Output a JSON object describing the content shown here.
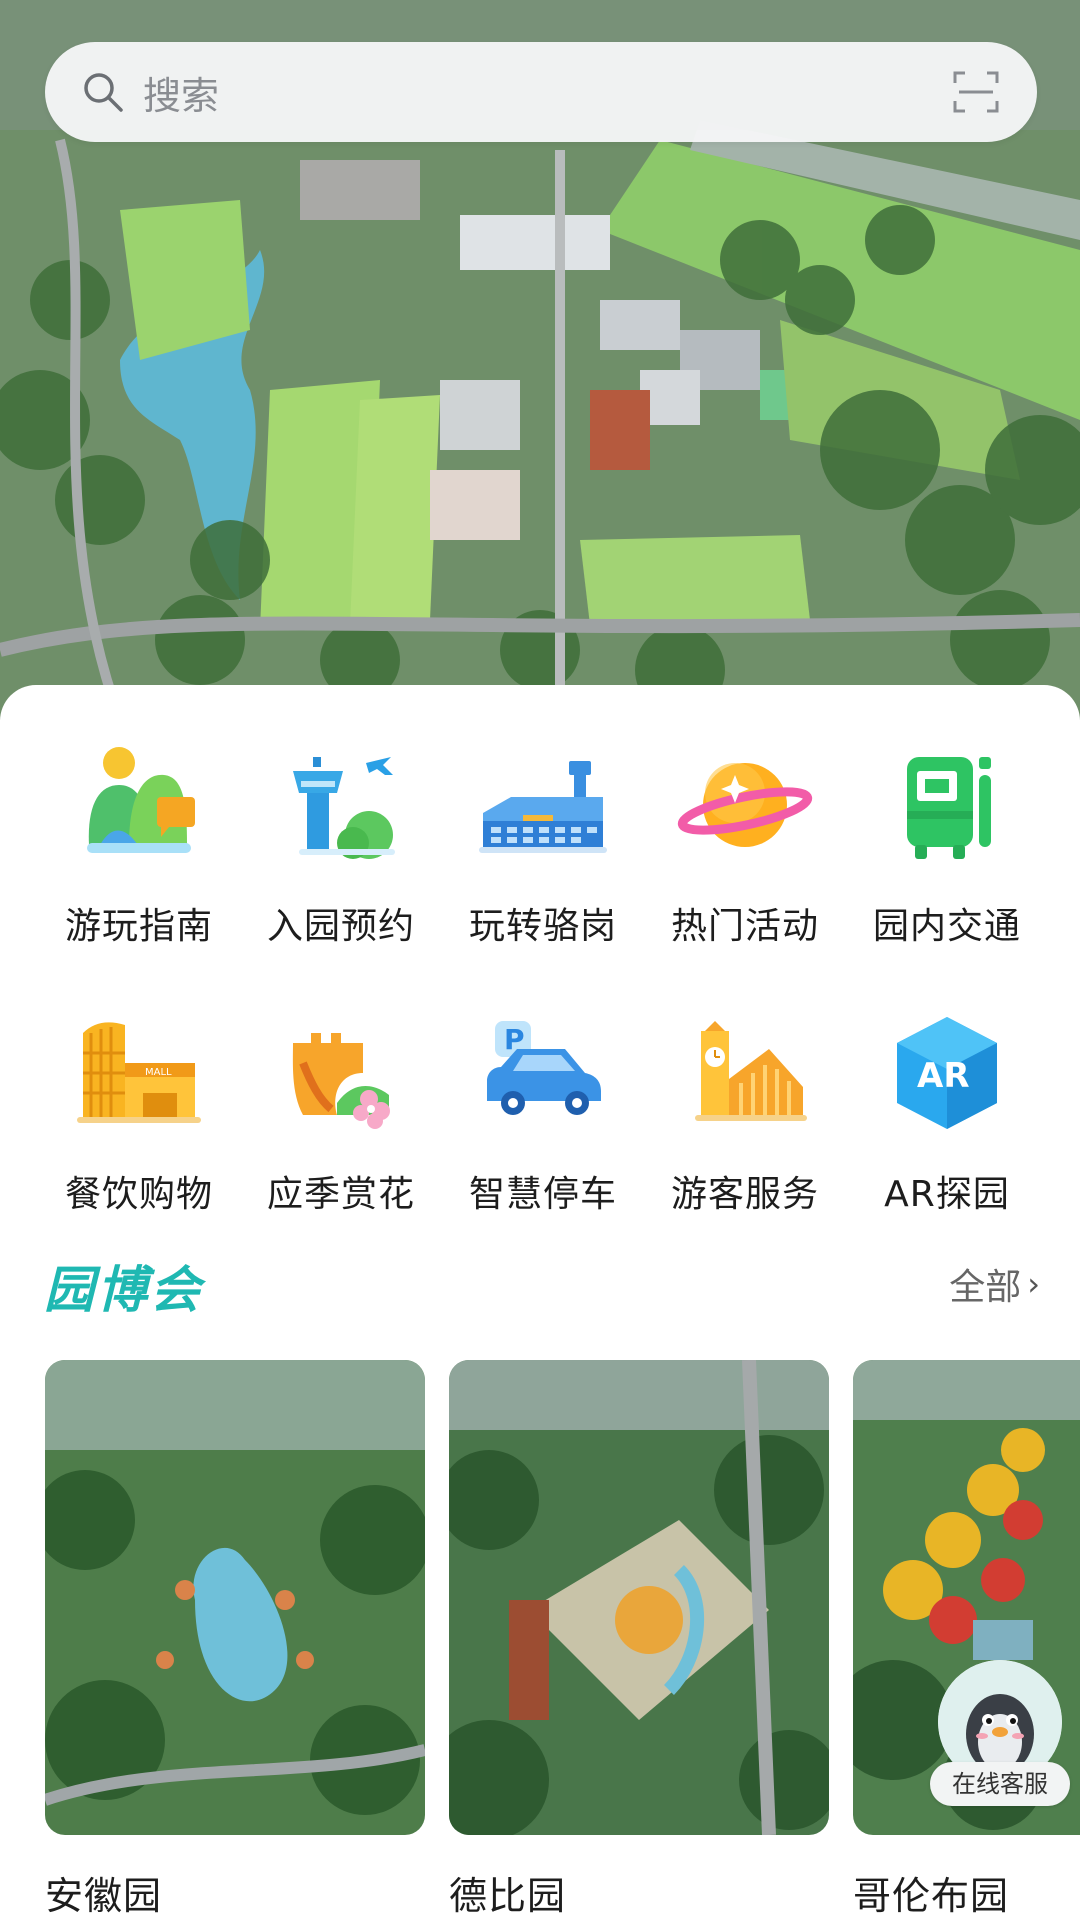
{
  "search": {
    "placeholder": "搜索"
  },
  "quick_menu": [
    {
      "label": "游玩指南",
      "icon": "guide-icon"
    },
    {
      "label": "入园预约",
      "icon": "tower-reservation-icon"
    },
    {
      "label": "玩转骆岗",
      "icon": "airport-building-icon"
    },
    {
      "label": "热门活动",
      "icon": "planet-icon"
    },
    {
      "label": "园内交通",
      "icon": "bus-icon"
    },
    {
      "label": "餐饮购物",
      "icon": "mall-icon"
    },
    {
      "label": "应季赏花",
      "icon": "flower-wall-icon"
    },
    {
      "label": "智慧停车",
      "icon": "parking-car-icon"
    },
    {
      "label": "游客服务",
      "icon": "clock-tower-icon"
    },
    {
      "label": "AR探园",
      "icon": "ar-cube-icon"
    }
  ],
  "section": {
    "title": "园博会",
    "more_label": "全部"
  },
  "gardens": [
    {
      "name": "安徽园"
    },
    {
      "name": "德比园"
    },
    {
      "name": "哥伦布园"
    }
  ],
  "customer_service": {
    "label": "在线客服"
  },
  "colors": {
    "accent": "#1fb8b2",
    "bus_green": "#2ec463",
    "building_blue": "#3a8fe0"
  }
}
